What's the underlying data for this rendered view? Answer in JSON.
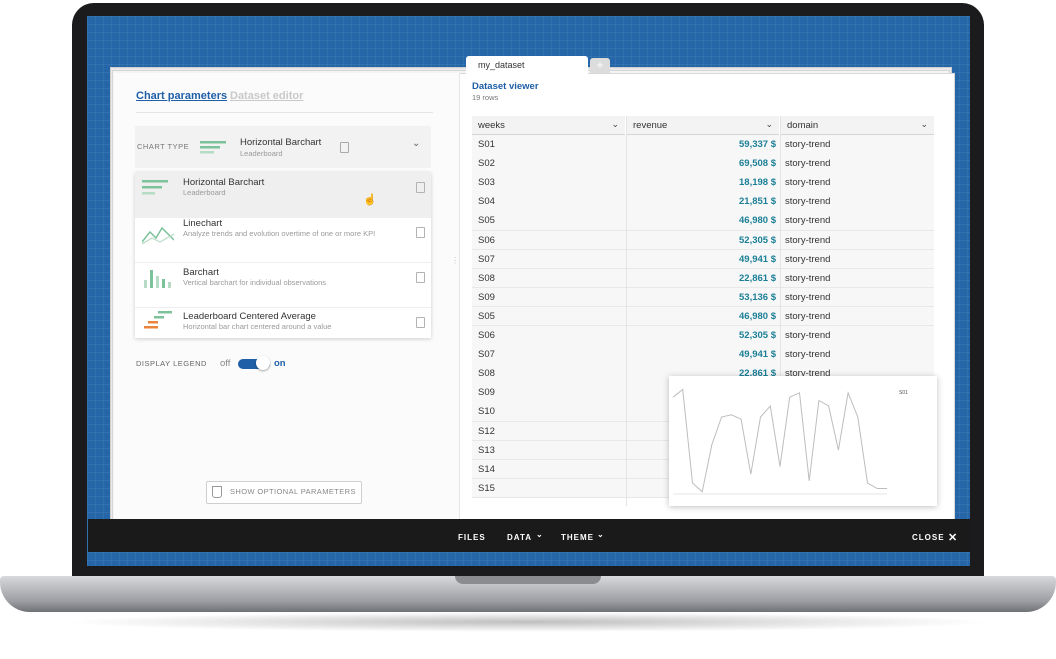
{
  "left_panel": {
    "tabs": [
      "Chart parameters",
      "Dataset editor"
    ],
    "chart_type_label": "CHART TYPE",
    "selected": {
      "title": "Horizontal Barchart",
      "subtitle": "Leaderboard"
    },
    "options": [
      {
        "title": "Horizontal Barchart",
        "subtitle": "Leaderboard",
        "icon": "horizontal-barchart-icon"
      },
      {
        "title": "Linechart",
        "subtitle": "Analyze trends and evolution overtime of one or more KPI",
        "icon": "linechart-icon"
      },
      {
        "title": "Barchart",
        "subtitle": "Vertical barchart for individual observations",
        "icon": "barchart-icon"
      },
      {
        "title": "Leaderboard Centered Average",
        "subtitle": "Horizontal bar chart centered around a value",
        "icon": "leaderboard-centered-icon"
      }
    ],
    "legend": {
      "label": "DISPLAY LEGEND",
      "off": "off",
      "on": "on",
      "state": "on"
    },
    "optional_button": "SHOW OPTIONAL PARAMETERS"
  },
  "dataset": {
    "tab_label": "my_dataset",
    "add_tab": "+",
    "viewer_title": "Dataset viewer",
    "row_count": "19 rows",
    "columns": [
      "weeks",
      "revenue",
      "domain"
    ],
    "rows": [
      [
        "S01",
        "59,337 $",
        "story-trend"
      ],
      [
        "S02",
        "69,508 $",
        "story-trend"
      ],
      [
        "S03",
        "18,198 $",
        "story-trend"
      ],
      [
        "S04",
        "21,851 $",
        "story-trend"
      ],
      [
        "S05",
        "46,980 $",
        "story-trend"
      ],
      [
        "S06",
        "52,305 $",
        "story-trend"
      ],
      [
        "S07",
        "49,941 $",
        "story-trend"
      ],
      [
        "S08",
        "22,861 $",
        "story-trend"
      ],
      [
        "S09",
        "53,136 $",
        "story-trend"
      ],
      [
        "S05",
        "46,980 $",
        "story-trend"
      ],
      [
        "S06",
        "52,305 $",
        "story-trend"
      ],
      [
        "S07",
        "49,941 $",
        "story-trend"
      ],
      [
        "S08",
        "22,861 $",
        "story-trend"
      ],
      [
        "S09",
        "",
        ""
      ],
      [
        "S10",
        "",
        ""
      ],
      [
        "S12",
        "",
        ""
      ],
      [
        "S13",
        "",
        ""
      ],
      [
        "S14",
        "",
        ""
      ],
      [
        "S15",
        "",
        ""
      ]
    ]
  },
  "bottom_bar": {
    "files": "FILES",
    "data": "DATA",
    "theme": "THEME",
    "close": "CLOSE",
    "chevron": "⌄",
    "close_icon": "✕"
  },
  "colors": {
    "accent": "#1f5fa8",
    "revenue_text": "#1b7f96",
    "screen_bg": "#2466a8",
    "bar_green": "#7cc29a",
    "bar_orange": "#e8843b"
  },
  "chart_data": {
    "type": "line",
    "title": "",
    "legend": [
      "S01"
    ],
    "series": [
      {
        "values": [
          88,
          95,
          10,
          2,
          45,
          70,
          72,
          68,
          18,
          70,
          80,
          25,
          88,
          92,
          12,
          85,
          80,
          40,
          92,
          70,
          10,
          5,
          5
        ]
      }
    ],
    "ylim": [
      0,
      100
    ]
  }
}
